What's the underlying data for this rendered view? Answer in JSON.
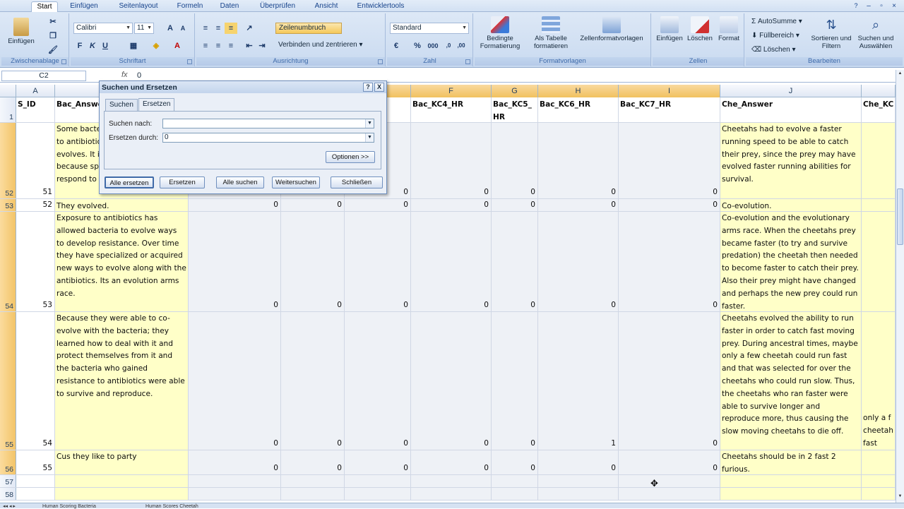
{
  "ribbon_tabs": [
    "Start",
    "Einfügen",
    "Seitenlayout",
    "Formeln",
    "Daten",
    "Überprüfen",
    "Ansicht",
    "Entwicklertools"
  ],
  "groups": {
    "clipboard": {
      "label": "Zwischenablage",
      "paste": "Einfügen"
    },
    "font": {
      "label": "Schriftart",
      "font_name": "Calibri",
      "font_size": "11",
      "bold": "F",
      "italic": "K",
      "underline": "U"
    },
    "alignment": {
      "label": "Ausrichtung",
      "wrap": "Zeilenumbruch",
      "merge": "Verbinden und zentrieren"
    },
    "number": {
      "label": "Zahl",
      "format": "Standard",
      "percent": "%",
      "thousands": "000"
    },
    "styles": {
      "label": "Formatvorlagen",
      "conditional": "Bedingte Formatierung",
      "as_table": "Als Tabelle formatieren",
      "cell_styles": "Zellenformatvorlagen"
    },
    "cells": {
      "label": "Zellen",
      "insert": "Einfügen",
      "delete": "Löschen",
      "format": "Format"
    },
    "editing": {
      "label": "Bearbeiten",
      "autosum": "AutoSumme",
      "fill": "Füllbereich",
      "clear": "Löschen",
      "sort": "Sortieren und Filtern",
      "find": "Suchen und Auswählen"
    }
  },
  "formula_bar": {
    "name_box": "C2",
    "fx": "fx",
    "value": "0"
  },
  "columns": [
    "A",
    "B",
    "C",
    "D",
    "E",
    "F",
    "G",
    "H",
    "I",
    "J",
    ""
  ],
  "header_row": {
    "num": "1",
    "A": "S_ID",
    "B": "Bac_Answer",
    "E": "R",
    "F": "Bac_KC4_HR",
    "G": "Bac_KC5_HR",
    "H": "Bac_KC6_HR",
    "I": "Bac_KC7_HR",
    "J": "Che_Answer",
    "K": "Che_KC"
  },
  "rows": [
    {
      "num": "52",
      "id": "51",
      "bac": "Some bacteria develop resistance to antibiotics as their species evolves. It is not reproduction because species aligned to respond to",
      "vals": [
        "0",
        "0",
        "0",
        "0",
        "0",
        "0",
        "0"
      ],
      "che": "Cheetahs had to evolve a faster running speed to be able to catch their prey, since the prey may have evolved faster running abilities for survival.",
      "k": ""
    },
    {
      "num": "53",
      "id": "52",
      "bac": "They evolved.",
      "vals": [
        "0",
        "0",
        "0",
        "0",
        "0",
        "0",
        "0"
      ],
      "che": "Co-evolution.",
      "k": ""
    },
    {
      "num": "54",
      "id": "53",
      "bac": "Exposure to antibiotics has allowed bacteria to evolve ways to develop resistance. Over time they have specialized or acquired new ways to evolve along with the antibiotics. Its an evolution arms race.",
      "vals": [
        "0",
        "0",
        "0",
        "0",
        "0",
        "0",
        "0"
      ],
      "che": "Co-evolution and the evolutionary arms race. When the cheetahs prey became faster (to try and survive predation) the cheetah then needed to become faster to catch their prey. Also their prey might have changed and perhaps the new prey could run faster.",
      "k": ""
    },
    {
      "num": "55",
      "id": "54",
      "bac": "Because they were able to co-evolve with the bacteria; they learned how to deal with it and protect themselves from it and the bacteria who gained resistance to antibiotics were able to survive and reproduce.",
      "vals": [
        "0",
        "0",
        "0",
        "0",
        "0",
        "1",
        "0"
      ],
      "che": "Cheetahs evolved the ability to run faster in order to catch fast moving prey. During ancestral times, maybe only a few cheetah could run fast and that was selected for over the cheetahs who could run slow. Thus, the cheetahs who ran faster were able to survive longer and reproduce more, thus causing the slow moving cheetahs to die off.",
      "k": "only a f cheetah fast"
    },
    {
      "num": "56",
      "id": "55",
      "bac": "Cus they like to party",
      "vals": [
        "0",
        "0",
        "0",
        "0",
        "0",
        "0",
        "0"
      ],
      "che": "Cheetahs should be in 2 fast 2 furious.",
      "k": ""
    },
    {
      "num": "57",
      "id": "",
      "bac": "",
      "vals": [
        "",
        "",
        "",
        "",
        "",
        "",
        ""
      ],
      "che": "",
      "k": ""
    },
    {
      "num": "58",
      "id": "",
      "bac": "",
      "vals": [
        "",
        "",
        "",
        "",
        "",
        "",
        ""
      ],
      "che": "",
      "k": ""
    }
  ],
  "dialog": {
    "title": "Suchen und Ersetzen",
    "help": "?",
    "close": "X",
    "tab_find": "Suchen",
    "tab_replace": "Ersetzen",
    "find_label": "Suchen nach:",
    "find_value": "",
    "replace_label": "Ersetzen durch:",
    "replace_value": "0",
    "options": "Optionen >>",
    "btn_replace_all": "Alle ersetzen",
    "btn_replace": "Ersetzen",
    "btn_find_all": "Alle suchen",
    "btn_find_next": "Weitersuchen",
    "btn_close": "Schließen"
  },
  "sheet_tabs": [
    "Human Scoring Bacteria",
    "Human Scores Cheetah"
  ]
}
